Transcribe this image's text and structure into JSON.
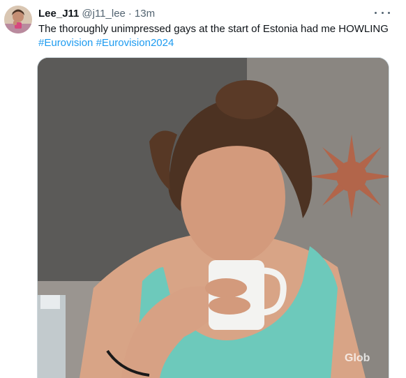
{
  "tweet": {
    "author_name": "Lee_J11",
    "handle": "@j11_lee",
    "separator": "·",
    "timestamp": "13m",
    "text": "The thoroughly unimpressed gays at the start of Estonia had me HOWLING",
    "hashtags": [
      "#Eurovision",
      "#Eurovision2024"
    ],
    "media": {
      "description_icon": "gif-image",
      "watermark": "Glob"
    }
  },
  "icons": {
    "more": "more-horizontal-icon",
    "avatar": "user-avatar"
  },
  "colors": {
    "link": "#1d9bf0",
    "secondary_text": "#536471",
    "primary_text": "#0f1419",
    "border": "#cfd9de"
  }
}
